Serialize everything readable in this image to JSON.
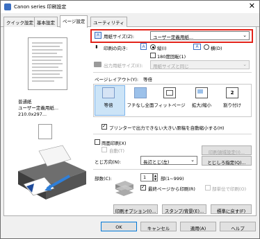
{
  "window": {
    "title": "Canon        series 印刷設定"
  },
  "tabs": [
    {
      "label": "クイック設定"
    },
    {
      "label": "基本設定"
    },
    {
      "label": "ページ設定",
      "active": true
    },
    {
      "label": "ユーティリティ"
    }
  ],
  "preview": {
    "media_line1": "普通紙",
    "media_line2": "ユーザー定義用紙... 210.0x297..."
  },
  "page_size": {
    "label": "用紙サイズ(Z):",
    "value": "ユーザー定義用紙..."
  },
  "orientation": {
    "label": "印刷の向き:",
    "portrait_label": "縦(I)",
    "landscape_label": "横(D)",
    "rotate180_label": "180度回転(1)",
    "selected": "portrait"
  },
  "output_size": {
    "label": "出力用紙サイズ(E):",
    "value": "用紙サイズと同じ"
  },
  "page_layout": {
    "label": "ページレイアウト(Y):",
    "current": "等倍",
    "options": [
      "等倍",
      "フチなし全面",
      "フィットページ",
      "拡大/縮小",
      "割り付け"
    ],
    "selected": "等倍",
    "option5_icon_number": "2"
  },
  "auto_reduce": {
    "label": "プリンターで出力できない大きい原稿を自動縮小する(H)",
    "checked": true
  },
  "duplex": {
    "label": "両面印刷(X)",
    "auto_label": "自動(T)",
    "area_button": "印刷領域設定(I)...",
    "checked": false
  },
  "binding": {
    "label": "とじ方向(N):",
    "value": "長辺とじ(左)",
    "margin_button": "とじしろ指定(Q)..."
  },
  "copies": {
    "label": "部数(C):",
    "value": "1",
    "range": "部(1~999)",
    "last_page_first_label": "最終ページから印刷(R)",
    "collate_label": "部単位で印刷(O)",
    "last_page_first_checked": true,
    "collate_checked": false
  },
  "bottom_buttons": {
    "print_options": "印刷オプション(I)...",
    "stamp": "スタンプ/背景(E)...",
    "defaults": "標準に戻す(F)"
  },
  "footer": {
    "ok": "OK",
    "cancel": "キャンセル",
    "apply": "適用(A)",
    "help": "ヘルプ"
  },
  "colors": {
    "highlight": "#e2231a",
    "accent": "#0078d7"
  }
}
